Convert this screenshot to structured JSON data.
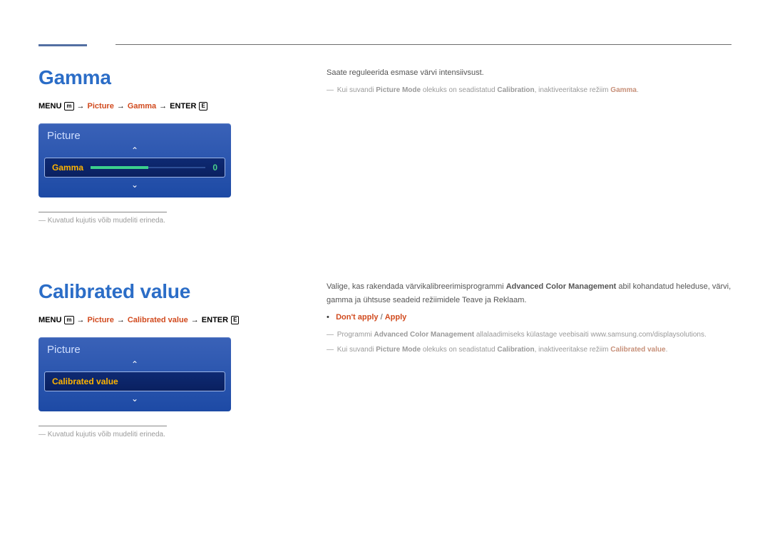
{
  "section1": {
    "title": "Gamma",
    "crumb": {
      "menu": "MENU",
      "menu_icon": "m",
      "p1": "Picture",
      "p2": "Gamma",
      "enter": "ENTER",
      "enter_icon": "E"
    },
    "osd": {
      "title": "Picture",
      "item_label": "Gamma",
      "item_value": "0"
    },
    "img_note": "Kuvatud kujutis võib mudeliti erineda.",
    "right": {
      "line1": "Saate reguleerida esmase värvi intensiivsust.",
      "note2_a": "Kui suvandi ",
      "note2_b": "Picture Mode",
      "note2_c": " olekuks on seadistatud ",
      "note2_d": "Calibration",
      "note2_e": ", inaktiveeritakse režiim ",
      "note2_f": "Gamma",
      "note2_g": "."
    }
  },
  "section2": {
    "title": "Calibrated value",
    "crumb": {
      "menu": "MENU",
      "menu_icon": "m",
      "p1": "Picture",
      "p2": "Calibrated value",
      "enter": "ENTER",
      "enter_icon": "E"
    },
    "osd": {
      "title": "Picture",
      "item_label": "Calibrated value"
    },
    "img_note": "Kuvatud kujutis võib mudeliti erineda.",
    "right": {
      "para_a": "Valige, kas rakendada värvikalibreerimisprogrammi ",
      "para_b": "Advanced Color Management",
      "para_c": " abil kohandatud heleduse, värvi, gamma ja ühtsuse seadeid režiimidele Teave ja Reklaam.",
      "opt1": "Don't apply",
      "opt_sep": " / ",
      "opt2": "Apply",
      "dl_a": "Programmi ",
      "dl_b": "Advanced Color Management",
      "dl_c": " allalaadimiseks külastage veebisaiti www.samsung.com/displaysolutions.",
      "cal_a": "Kui suvandi ",
      "cal_b": "Picture Mode",
      "cal_c": " olekuks on seadistatud ",
      "cal_d": "Calibration",
      "cal_e": ", inaktiveeritakse režiim ",
      "cal_f": "Calibrated value",
      "cal_g": "."
    }
  }
}
